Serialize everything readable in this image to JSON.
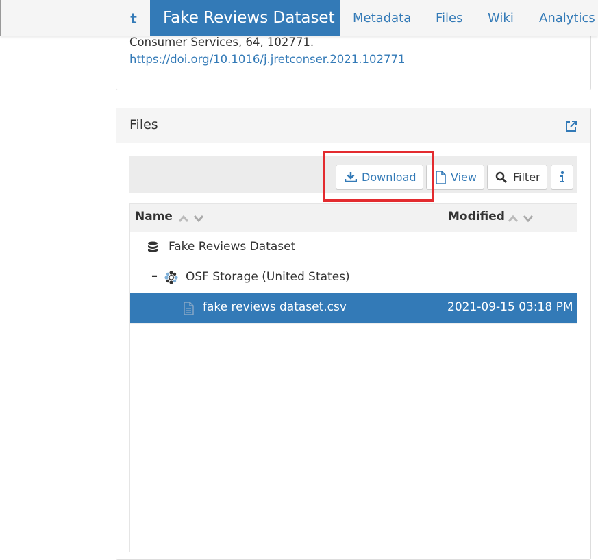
{
  "nav": {
    "up_arrow": "t",
    "brand": "Fake Reviews Dataset",
    "links": [
      "Metadata",
      "Files",
      "Wiki",
      "Analytics"
    ]
  },
  "citation": {
    "text_tail": "Consumer Services, 64, 102771.",
    "doi": "https://doi.org/10.1016/j.jretconser.2021.102771"
  },
  "files": {
    "title": "Files",
    "toolbar": {
      "download": "Download",
      "view": "View",
      "filter": "Filter"
    },
    "columns": {
      "name": "Name",
      "modified": "Modified"
    },
    "rows": [
      {
        "name": "Fake Reviews Dataset",
        "modified": ""
      },
      {
        "name": "OSF Storage (United States)",
        "modified": ""
      },
      {
        "name": "fake reviews dataset.csv",
        "modified": "2021-09-15 03:18 PM"
      }
    ]
  },
  "icons": {
    "download": "download-icon",
    "view": "file-icon",
    "filter": "search-icon",
    "info": "info-icon",
    "external": "external-link-icon",
    "database": "database-icon",
    "storage": "osf-storage-icon",
    "file": "file-icon"
  },
  "colors": {
    "primary": "#337ab7",
    "highlight": "#e32b2f"
  }
}
